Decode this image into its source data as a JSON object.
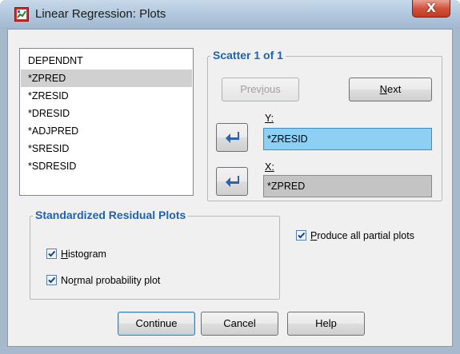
{
  "window": {
    "title": "Linear Regression: Plots",
    "close_symbol": "X"
  },
  "variables": [
    "DEPENDNT",
    "*ZPRED",
    "*ZRESID",
    "*DRESID",
    "*ADJPRED",
    "*SRESID",
    "*SDRESID"
  ],
  "selected_variable": "*ZPRED",
  "scatter": {
    "group_title": "Scatter 1 of 1",
    "previous_label": "Previous",
    "next_label": "Next",
    "y_label": "Y:",
    "y_value": "*ZRESID",
    "x_label": "X:",
    "x_value": "*ZPRED"
  },
  "residual_plots": {
    "group_title": "Standardized Residual Plots",
    "histogram_label": "Histogram",
    "histogram_checked": true,
    "normal_label": "Normal probability plot",
    "normal_checked": true
  },
  "partial": {
    "label": "Produce all partial plots",
    "checked": true
  },
  "buttons": {
    "continue_label": "Continue",
    "cancel_label": "Cancel",
    "help_label": "Help"
  },
  "colors": {
    "group_title": "#1b63b8",
    "y_field": "#8ed0f3",
    "x_field": "#c4c4c4",
    "arrow": "#2a63b5"
  }
}
